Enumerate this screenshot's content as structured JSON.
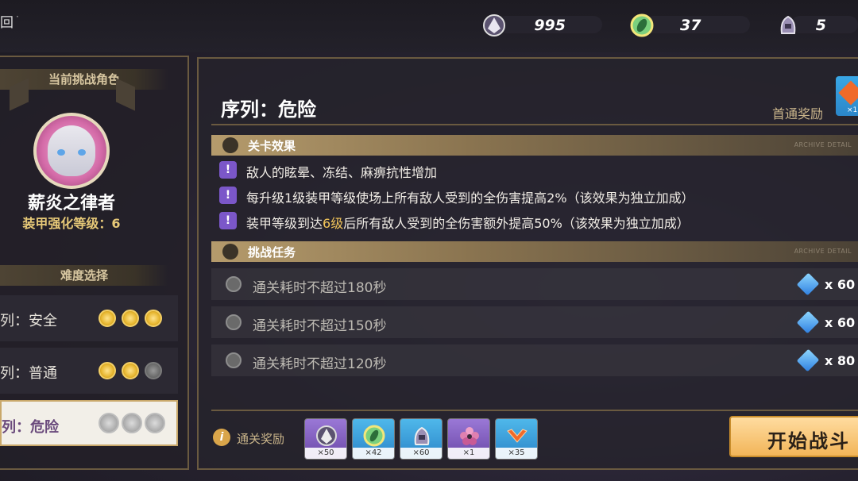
{
  "topbar": {
    "back_label": "回",
    "resources": [
      {
        "icon": "crystal-emblem-icon",
        "value": "995"
      },
      {
        "icon": "disc-coin-icon",
        "value": "37"
      },
      {
        "icon": "helmet-icon",
        "value": "5"
      }
    ]
  },
  "left": {
    "current_header": "当前挑战角色",
    "character_name": "薪炎之律者",
    "armor_level_label": "装甲强化等级：6",
    "difficulty_header": "难度选择",
    "difficulties": [
      {
        "label": "列：安全",
        "medals": [
          "gold",
          "gold",
          "gold"
        ]
      },
      {
        "label": "列：普通",
        "medals": [
          "gold",
          "gold",
          "grey"
        ]
      },
      {
        "label": "列：危险",
        "medals": [
          "silver",
          "silver",
          "silver"
        ],
        "selected": true
      }
    ]
  },
  "main": {
    "title": "序列：危险",
    "first_clear_label": "首通奖励",
    "first_clear_count": "×1",
    "stage_effects_title": "关卡效果",
    "challenge_tasks_title": "挑战任务",
    "archive_detail": "ARCHIVE DETAIL",
    "effects": [
      {
        "text": "敌人的眩晕、冻结、麻痹抗性增加"
      },
      {
        "text": "每升级1级装甲等级使场上所有敌人受到的全伤害提高2%（该效果为独立加成）"
      },
      {
        "pre": "装甲等级到达",
        "hl": "6级",
        "post": "后所有敌人受到的全伤害额外提高50%（该效果为独立加成）"
      }
    ],
    "tasks": [
      {
        "text": "通关耗时不超过180秒",
        "reward": "x 60"
      },
      {
        "text": "通关耗时不超过150秒",
        "reward": "x 60"
      },
      {
        "text": "通关耗时不超过120秒",
        "reward": "x 80"
      }
    ],
    "clear_reward_label": "通关奖励",
    "clear_rewards": [
      {
        "icon": "crystal-emblem-icon",
        "count": "×50",
        "color": "#7a55b8"
      },
      {
        "icon": "disc-coin-icon",
        "count": "×42",
        "color": "#3aa3d8"
      },
      {
        "icon": "helmet-icon",
        "count": "×60",
        "color": "#3aa3d8"
      },
      {
        "icon": "flower-icon",
        "count": "×1",
        "color": "#7a55b8"
      },
      {
        "icon": "chevron-emblem-icon",
        "count": "×35",
        "color": "#3aa3d8"
      }
    ],
    "start_button": "开始战斗"
  },
  "colors": {
    "accent_gold": "#e7c978",
    "frame": "#6a5a40",
    "warn_purple": "#7b57c9"
  }
}
